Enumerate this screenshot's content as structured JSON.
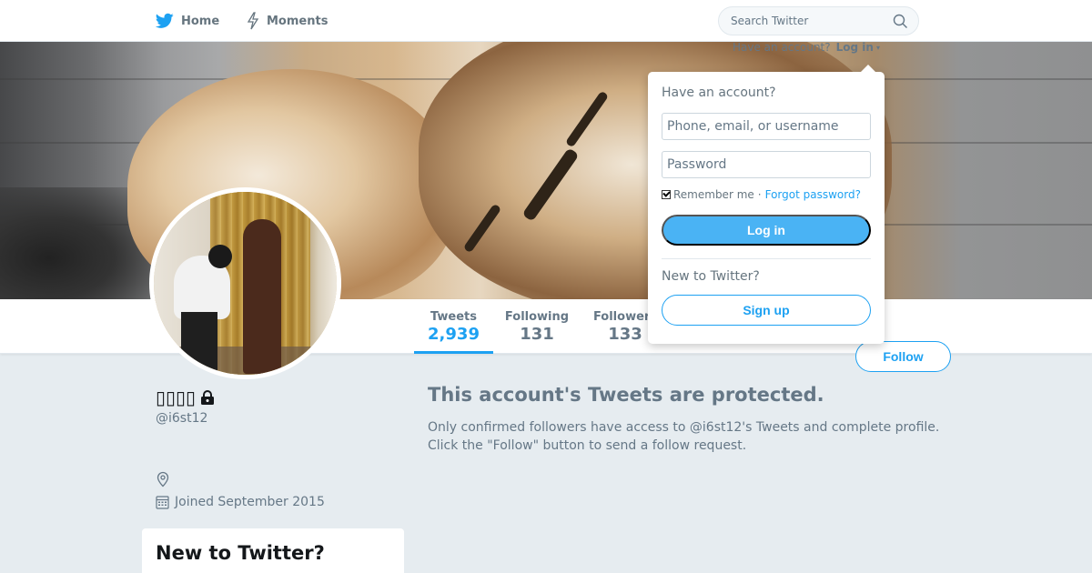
{
  "nav": {
    "home_label": "Home",
    "moments_label": "Moments",
    "search_placeholder": "Search Twitter",
    "brand_color": "#1da1f2"
  },
  "login_prompt": {
    "text": "Have an account?",
    "link": "Log in",
    "caret": "▾"
  },
  "dropdown": {
    "title": "Have an account?",
    "username_placeholder": "Phone, email, or username",
    "password_placeholder": "Password",
    "remember_label": "Remember me",
    "separator": "·",
    "forgot_label": "Forgot password?",
    "login_button": "Log in",
    "new_label": "New to Twitter?",
    "signup_button": "Sign up",
    "remember_checked": true
  },
  "stats": {
    "tweets_label": "Tweets",
    "tweets_value": "2,939",
    "following_label": "Following",
    "following_value": "131",
    "followers_label": "Followers",
    "followers_value": "133"
  },
  "follow_button": "Follow",
  "profile": {
    "name": "▯▯▯▯",
    "handle": "@i6st12",
    "joined": "Joined September 2015",
    "protected": true
  },
  "protected_message": {
    "title": "This account's Tweets are protected.",
    "line1": "Only confirmed followers have access to @i6st12's Tweets and complete profile.",
    "line2": "Click the \"Follow\" button to send a follow request."
  },
  "sidebar": {
    "new_title": "New to Twitter?"
  }
}
